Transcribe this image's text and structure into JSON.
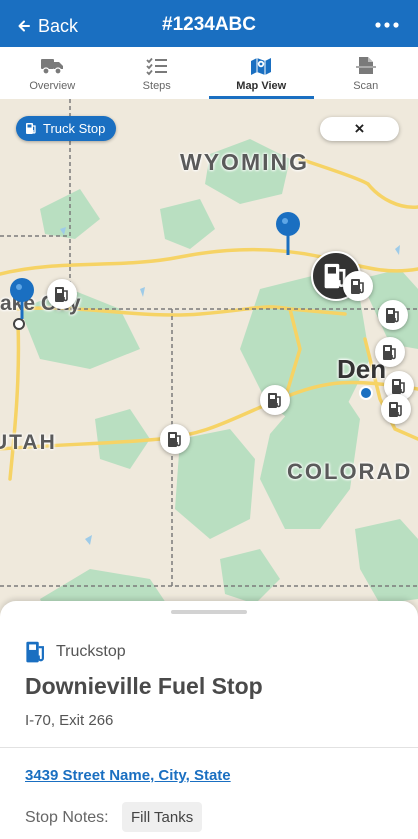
{
  "header": {
    "back_label": "Back",
    "title": "#1234ABC",
    "more_label": "•••"
  },
  "tabs": [
    {
      "label": "Overview",
      "icon": "truck-icon",
      "active": false
    },
    {
      "label": "Steps",
      "icon": "checklist-icon",
      "active": false
    },
    {
      "label": "Map View",
      "icon": "map-icon",
      "active": true
    },
    {
      "label": "Scan",
      "icon": "document-scan-icon",
      "active": false
    }
  ],
  "map": {
    "filter_chip": "Truck Stop",
    "close_label": "×",
    "labels": {
      "wyoming": "WYOMING",
      "utah": "UTAH",
      "colorado": "COLORAD",
      "city_left": "ake City",
      "city_right": "Den"
    }
  },
  "sheet": {
    "stop_type": "Truckstop",
    "stop_name": "Downieville Fuel Stop",
    "stop_sub": "I-70, Exit 266",
    "address": "3439 Street Name, City, State",
    "notes_label": "Stop Notes:",
    "notes_value": "Fill Tanks"
  },
  "colors": {
    "brand_blue": "#1a6fc1",
    "map_land": "#efe9dc",
    "forest_green": "#b9dfc1",
    "highway_yellow": "#f6d365"
  }
}
